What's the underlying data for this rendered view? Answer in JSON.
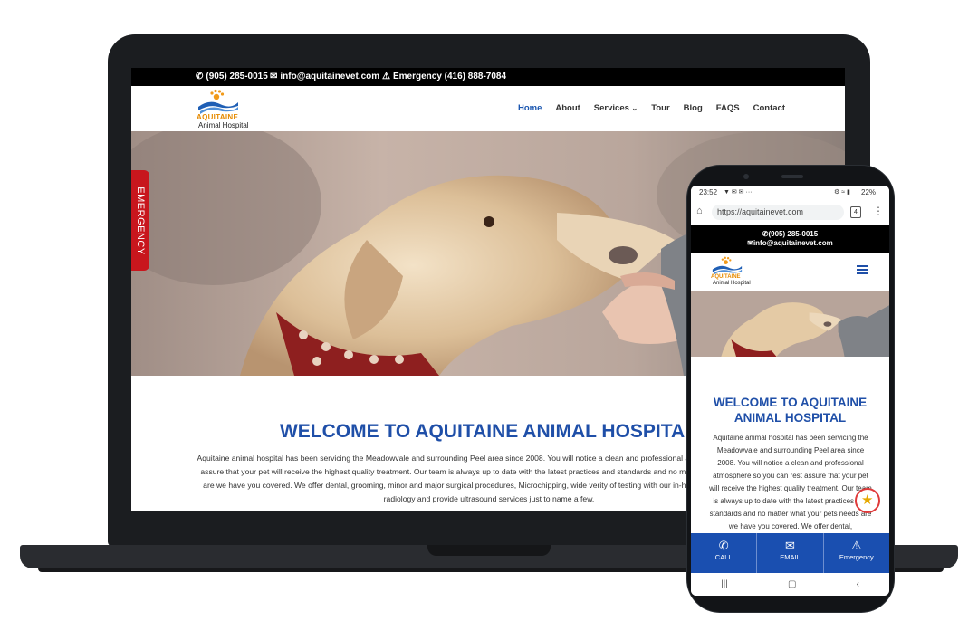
{
  "desktop": {
    "topbar": {
      "phone": "(905) 285-0015",
      "email": "info@aquitainevet.com",
      "emergency": "Emergency (416) 888-7084"
    },
    "logo": {
      "line1": "AQUITAINE",
      "line2": "Animal Hospital"
    },
    "nav": [
      {
        "label": "Home",
        "active": true
      },
      {
        "label": "About"
      },
      {
        "label": "Services"
      },
      {
        "label": "Tour"
      },
      {
        "label": "Blog"
      },
      {
        "label": "FAQS"
      },
      {
        "label": "Contact"
      }
    ],
    "emergency_tab": "EMERGENCY",
    "welcome_title": "WELCOME TO AQUITAINE ANIMAL HOSPITAL",
    "welcome_text": "Aquitaine animal hospital has been servicing the Meadowvale and surrounding Peel area since 2008. You will notice a clean and professional atmosphere so you can rest assure that your pet will receive the highest quality treatment. Our team is always up to date with the latest practices and standards and no matter what your pets needs are we have you covered. We offer dental, grooming, minor and major surgical procedures, Microchipping, wide verity of testing with our in-house lab where we do our radiology and provide ultrasound services just to name a few."
  },
  "mobile": {
    "status": {
      "time": "23:52",
      "battery": "22%"
    },
    "url": "https://aquitainevet.com",
    "tab_count": "4",
    "topbar": {
      "phone": "(905) 285-0015",
      "email": "info@aquitainevet.com"
    },
    "logo": {
      "line1": "AQUITAINE",
      "line2": "Animal Hospital"
    },
    "welcome_title": "WELCOME TO AQUITAINE ANIMAL HOSPITAL",
    "welcome_text": "Aquitaine animal hospital has been servicing the Meadowvale and surrounding Peel area since 2008. You will notice a clean and professional atmosphere so you can rest assure that your pet will receive the highest quality treatment. Our team is always up to date with the latest practices and standards and no matter what your pets needs are we have you covered. We offer dental,",
    "bottom_bar": [
      {
        "label": "CALL",
        "icon": "phone-icon"
      },
      {
        "label": "EMAIL",
        "icon": "envelope-icon"
      },
      {
        "label": "Emergency",
        "icon": "warning-icon"
      }
    ]
  },
  "colors": {
    "brand_blue": "#1f4fa8",
    "emergency_red": "#c8161d",
    "accent_orange": "#e68a00",
    "bottom_bar": "#1a4fb0"
  }
}
